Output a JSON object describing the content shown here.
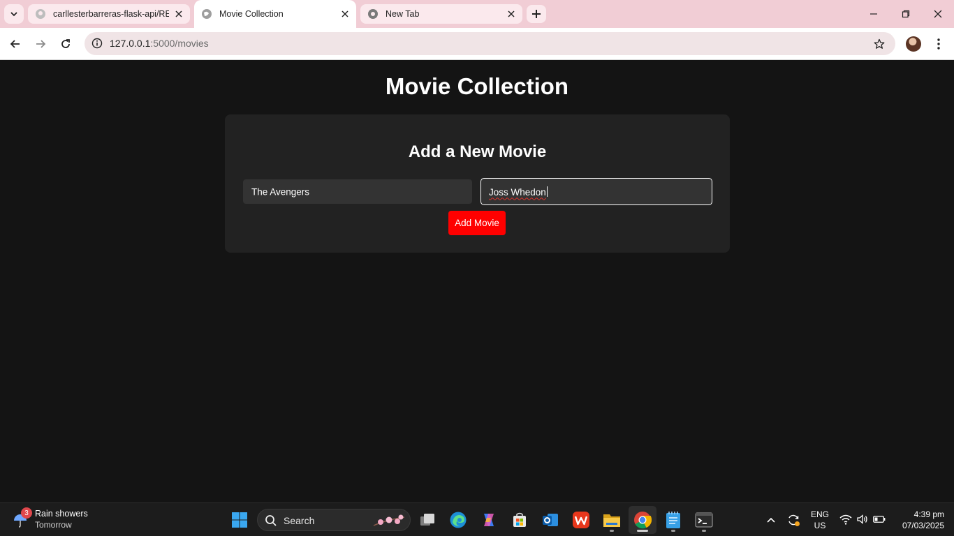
{
  "browser": {
    "tabs": [
      {
        "title": "carllesterbarreras-flask-api/REA",
        "favicon": "github-icon",
        "active": false
      },
      {
        "title": "Movie Collection",
        "favicon": "globe-icon",
        "active": true
      },
      {
        "title": "New Tab",
        "favicon": "chrome-icon",
        "active": false
      }
    ],
    "url_host": "127.0.0.1",
    "url_path": ":5000/movies"
  },
  "page": {
    "title": "Movie Collection",
    "form": {
      "heading": "Add a New Movie",
      "title_value": "The Avengers",
      "director_value": "Joss Whedon",
      "submit_label": "Add Movie"
    }
  },
  "colors": {
    "page_bg": "#141414",
    "card_bg": "#222222",
    "input_bg": "#333333",
    "accent_button": "#ff0000",
    "tabstrip_bg": "#f1cdd5"
  },
  "taskbar": {
    "weather": {
      "badge": "3",
      "line1": "Rain showers",
      "line2": "Tomorrow"
    },
    "search_label": "Search",
    "apps": [
      "start-icon",
      "task-view-icon",
      "edge-icon",
      "copilot-icon",
      "store-icon",
      "outlook-icon",
      "wps-icon",
      "file-explorer-icon",
      "chrome-icon",
      "notepad-icon",
      "terminal-icon"
    ],
    "tray": {
      "lang1": "ENG",
      "lang2": "US",
      "time": "4:39 pm",
      "date": "07/03/2025"
    }
  }
}
